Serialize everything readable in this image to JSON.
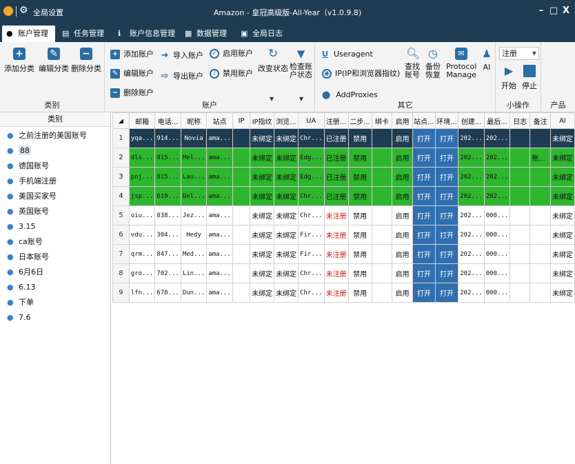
{
  "titlebar": {
    "settings": "全局设置",
    "title": "Amazon - 皇冠高级版-All-Year（v1.0.9.8)",
    "minimize": "–",
    "maximize": "□",
    "close": "X"
  },
  "tabs": [
    {
      "label": "账户管理"
    },
    {
      "label": "任务管理"
    },
    {
      "label": "账户信息管理"
    },
    {
      "label": "数据管理"
    },
    {
      "label": "全局日志"
    }
  ],
  "ribbon": {
    "category": {
      "label": "类别",
      "add": "添加分类",
      "edit": "编辑分类",
      "delete": "删除分类"
    },
    "account": {
      "label": "账户",
      "add": "添加账户",
      "edit": "编辑账户",
      "delete": "删除账户",
      "import": "导入账户",
      "export": "导出账户",
      "enable": "启用账户",
      "disable": "禁用账户",
      "change_status": "改变状态",
      "check_status_1": "检查账",
      "check_status_2": "户状态"
    },
    "other": {
      "label": "其它",
      "useragent": "Useragent",
      "ip": "IP(IP和浏览器指纹)",
      "proxies": "AddProxies",
      "find_1": "查找",
      "find_2": "账号",
      "backup_1": "备份",
      "backup_2": "恢复",
      "protocol_1": "Protocol",
      "protocol_2": "Manage",
      "ai": "AI"
    },
    "mini": {
      "label": "小操作",
      "select": "注册",
      "start": "开始",
      "stop": "停止"
    },
    "product": {
      "label": "产品"
    }
  },
  "categories": {
    "header": "类别",
    "items": [
      "之前注册的美国账号",
      "88",
      "德国账号",
      "手机端注册",
      "美国买家号",
      "英国账号",
      "3.15",
      "ca账号",
      "日本账号",
      "6月6日",
      "6.13",
      "下单",
      "7.6"
    ]
  },
  "grid": {
    "columns": [
      "邮箱",
      "电话...",
      "昵称",
      "站点",
      "IP",
      "IP指纹",
      "浏览...",
      "UA",
      "注册...",
      "二步...",
      "绑卡",
      "启用",
      "站点...",
      "环境...",
      "创建...",
      "最后...",
      "日志",
      "备注",
      "AI"
    ],
    "rows": [
      {
        "n": "1",
        "style": "dark",
        "email": "yqa...",
        "phone": "914...",
        "nick": "Novia",
        "site": "ama...",
        "ip": "",
        "ipfp": "未绑定",
        "browser": "未绑定",
        "ua": "Chr...",
        "reg": "已注册",
        "twostep": "禁用",
        "card": "",
        "enable": "启用",
        "siteop": "打开",
        "envop": "打开",
        "created": "202...",
        "last": "202...",
        "log": "",
        "note": "",
        "ai": "未绑定"
      },
      {
        "n": "2",
        "style": "green",
        "email": "dls...",
        "phone": "815...",
        "nick": "Mel...",
        "site": "ama...",
        "ip": "",
        "ipfp": "未绑定",
        "browser": "未绑定",
        "ua": "Edg...",
        "reg": "已注册",
        "twostep": "禁用",
        "card": "",
        "enable": "启用",
        "siteop": "打开",
        "envop": "打开",
        "created": "202...",
        "last": "202...",
        "log": "",
        "note": "账...",
        "ai": "未绑定"
      },
      {
        "n": "3",
        "style": "green",
        "email": "pnj...",
        "phone": "815...",
        "nick": "Lau...",
        "site": "ama...",
        "ip": "",
        "ipfp": "未绑定",
        "browser": "未绑定",
        "ua": "Edg...",
        "reg": "已注册",
        "twostep": "禁用",
        "card": "",
        "enable": "启用",
        "siteop": "打开",
        "envop": "打开",
        "created": "202...",
        "last": "202...",
        "log": "",
        "note": "",
        "ai": "未绑定"
      },
      {
        "n": "4",
        "style": "green",
        "email": "jsp...",
        "phone": "619...",
        "nick": "Del...",
        "site": "ama...",
        "ip": "",
        "ipfp": "未绑定",
        "browser": "未绑定",
        "ua": "Chr...",
        "reg": "已注册",
        "twostep": "禁用",
        "card": "",
        "enable": "启用",
        "siteop": "打开",
        "envop": "打开",
        "created": "202...",
        "last": "202...",
        "log": "",
        "note": "",
        "ai": "未绑定"
      },
      {
        "n": "5",
        "style": "white",
        "email": "oiu...",
        "phone": "838...",
        "nick": "Jez...",
        "site": "ama...",
        "ip": "",
        "ipfp": "未绑定",
        "browser": "未绑定",
        "ua": "Chr...",
        "reg": "未注册",
        "twostep": "禁用",
        "card": "",
        "enable": "启用",
        "siteop": "打开",
        "envop": "打开",
        "created": "202...",
        "last": "000...",
        "log": "",
        "note": "",
        "ai": "未绑定"
      },
      {
        "n": "6",
        "style": "white",
        "email": "vdu...",
        "phone": "304...",
        "nick": "Hedy",
        "site": "ama...",
        "ip": "",
        "ipfp": "未绑定",
        "browser": "未绑定",
        "ua": "Fir...",
        "reg": "未注册",
        "twostep": "禁用",
        "card": "",
        "enable": "启用",
        "siteop": "打开",
        "envop": "打开",
        "created": "202...",
        "last": "000...",
        "log": "",
        "note": "",
        "ai": "未绑定"
      },
      {
        "n": "7",
        "style": "white",
        "email": "qrm...",
        "phone": "847...",
        "nick": "Med...",
        "site": "ama...",
        "ip": "",
        "ipfp": "未绑定",
        "browser": "未绑定",
        "ua": "Fir...",
        "reg": "未注册",
        "twostep": "禁用",
        "card": "",
        "enable": "启用",
        "siteop": "打开",
        "envop": "打开",
        "created": "202...",
        "last": "000...",
        "log": "",
        "note": "",
        "ai": "未绑定"
      },
      {
        "n": "8",
        "style": "white",
        "email": "gro...",
        "phone": "702...",
        "nick": "Lin...",
        "site": "ama...",
        "ip": "",
        "ipfp": "未绑定",
        "browser": "未绑定",
        "ua": "Chr...",
        "reg": "未注册",
        "twostep": "禁用",
        "card": "",
        "enable": "启用",
        "siteop": "打开",
        "envop": "打开",
        "created": "202...",
        "last": "000...",
        "log": "",
        "note": "",
        "ai": "未绑定"
      },
      {
        "n": "9",
        "style": "white",
        "email": "lfn...",
        "phone": "678...",
        "nick": "Dun...",
        "site": "ama...",
        "ip": "",
        "ipfp": "未绑定",
        "browser": "未绑定",
        "ua": "Chr...",
        "reg": "未注册",
        "twostep": "禁用",
        "card": "",
        "enable": "启用",
        "siteop": "打开",
        "envop": "打开",
        "created": "202...",
        "last": "000...",
        "log": "",
        "note": "",
        "ai": "未绑定"
      }
    ]
  },
  "colors": {
    "titlebar": "#1e3d52",
    "accent": "#2b6ea6",
    "row_green": "#2eb62e",
    "open_btn": "#2f6fb0",
    "unregistered": "#e01010"
  }
}
